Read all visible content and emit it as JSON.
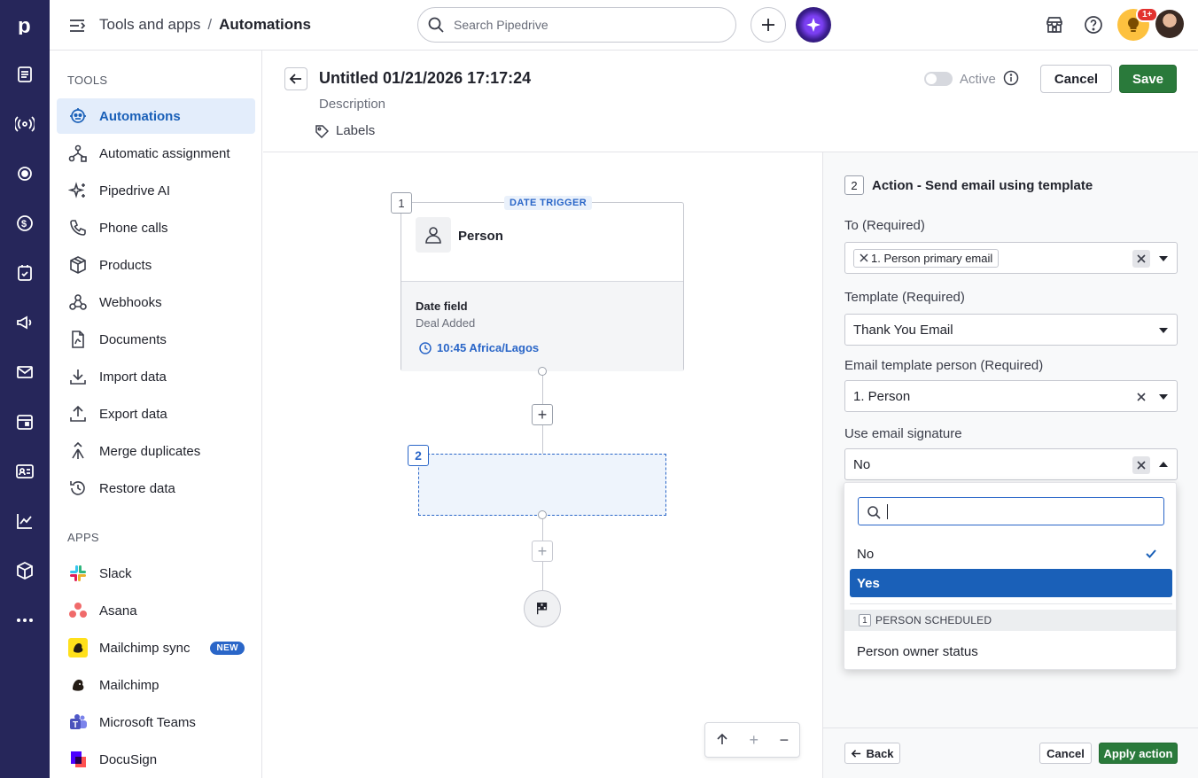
{
  "header": {
    "breadcrumb_parent": "Tools and apps",
    "breadcrumb_sep": "/",
    "breadcrumb_current": "Automations",
    "search_placeholder": "Search Pipedrive",
    "notification_badge": "1+"
  },
  "sidebar": {
    "tools_heading": "TOOLS",
    "tools": [
      {
        "label": "Automations",
        "icon": "automation-robot-icon",
        "active": true
      },
      {
        "label": "Automatic assignment",
        "icon": "assignment-icon"
      },
      {
        "label": "Pipedrive AI",
        "icon": "sparkle-icon"
      },
      {
        "label": "Phone calls",
        "icon": "phone-icon"
      },
      {
        "label": "Products",
        "icon": "box-icon"
      },
      {
        "label": "Webhooks",
        "icon": "webhook-icon"
      },
      {
        "label": "Documents",
        "icon": "document-icon"
      },
      {
        "label": "Import data",
        "icon": "download-icon"
      },
      {
        "label": "Export data",
        "icon": "upload-icon"
      },
      {
        "label": "Merge duplicates",
        "icon": "merge-icon"
      },
      {
        "label": "Restore data",
        "icon": "restore-icon"
      }
    ],
    "apps_heading": "APPS",
    "apps": [
      {
        "label": "Slack",
        "icon": "slack-logo-icon"
      },
      {
        "label": "Asana",
        "icon": "asana-logo-icon"
      },
      {
        "label": "Mailchimp sync",
        "icon": "mailchimp-logo-icon",
        "badge": "NEW"
      },
      {
        "label": "Mailchimp",
        "icon": "mailchimp-logo-icon"
      },
      {
        "label": "Microsoft Teams",
        "icon": "teams-logo-icon"
      },
      {
        "label": "DocuSign",
        "icon": "docusign-logo-icon"
      }
    ]
  },
  "automation": {
    "title": "Untitled 01/21/2026 17:17:24",
    "description_placeholder": "Description",
    "labels": "Labels",
    "active_label": "Active",
    "active": false,
    "cancel_label": "Cancel",
    "save_label": "Save"
  },
  "canvas": {
    "trigger": {
      "step": "1",
      "tag": "DATE TRIGGER",
      "entity": "Person",
      "field_label": "Date field",
      "field_value": "Deal Added",
      "time": "10:45 Africa/Lagos"
    },
    "step2": "2"
  },
  "panel": {
    "step": "2",
    "title": "Action - Send email using template",
    "to_label": "To (Required)",
    "to_chip": "1. Person primary email",
    "template_label": "Template (Required)",
    "template_value": "Thank You Email",
    "person_label": "Email template person (Required)",
    "person_value": "1. Person",
    "signature_label": "Use email signature",
    "signature_value": "No",
    "back_label": "Back",
    "cancel_label": "Cancel",
    "apply_label": "Apply action"
  },
  "dropdown": {
    "search_value": "",
    "options": [
      "No",
      "Yes"
    ],
    "selected": "No",
    "highlighted": "Yes",
    "group_num": "1",
    "group_label": "PERSON SCHEDULED",
    "group_option": "Person owner status"
  },
  "colors": {
    "rail": "#26265a",
    "accent": "#1a60b8",
    "save": "#2a7a3b"
  }
}
